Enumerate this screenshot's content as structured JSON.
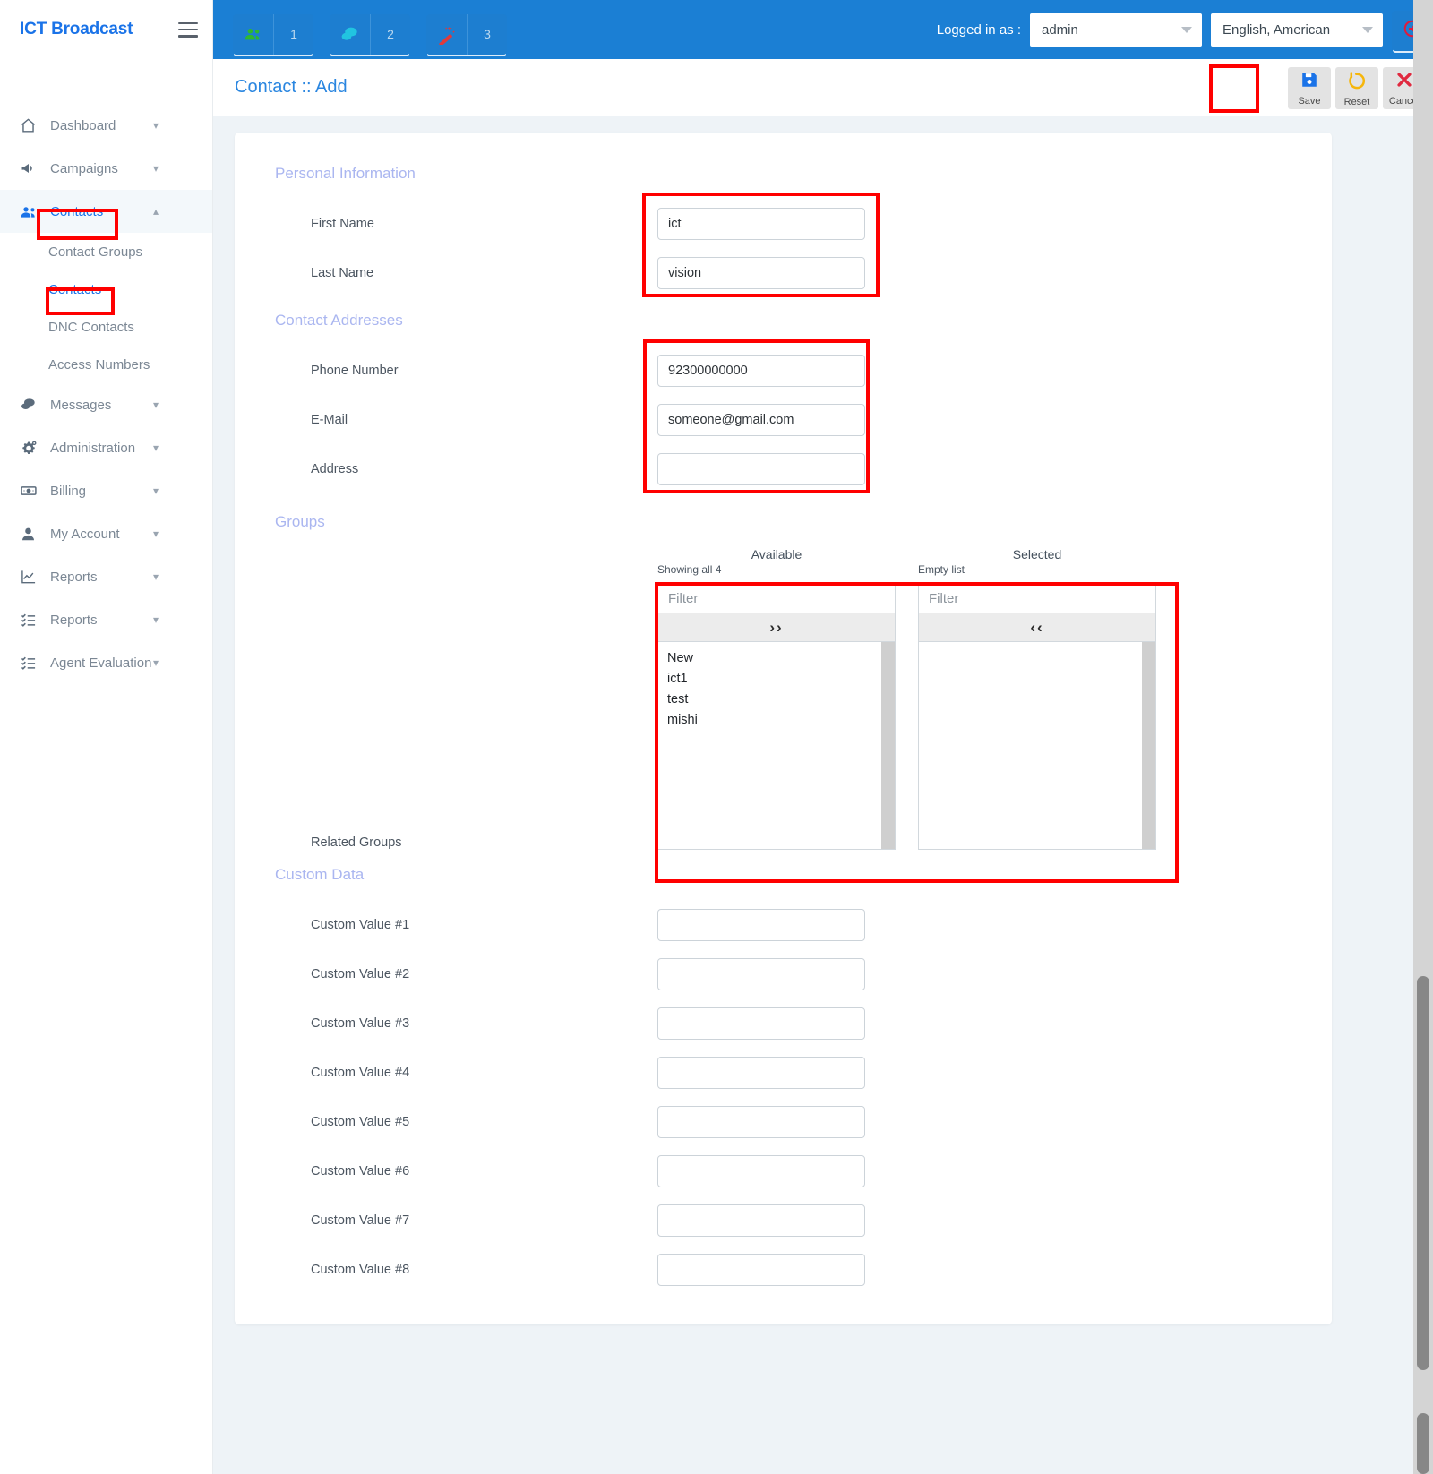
{
  "brand": {
    "title": "ICT Broadcast",
    "menu_icon": "hamburger-icon"
  },
  "sidebar": {
    "items": [
      {
        "label": "Dashboard",
        "icon": "home-icon",
        "chevron": "⌄",
        "active": false
      },
      {
        "label": "Campaigns",
        "icon": "megaphone-icon",
        "chevron": "⌄",
        "active": false
      },
      {
        "label": "Contacts",
        "icon": "users-icon",
        "chevron": "⌃",
        "active": true
      },
      {
        "label": "Messages",
        "icon": "chat-icon",
        "chevron": "⌄",
        "active": false
      },
      {
        "label": "Administration",
        "icon": "gears-icon",
        "chevron": "⌄",
        "active": false
      },
      {
        "label": "Billing",
        "icon": "money-icon",
        "chevron": "⌄",
        "active": false
      },
      {
        "label": "My Account",
        "icon": "user-icon",
        "chevron": "⌄",
        "active": false
      },
      {
        "label": "Reports",
        "icon": "chart-line-icon",
        "chevron": "⌄",
        "active": false
      },
      {
        "label": "Reports",
        "icon": "list-check-icon",
        "chevron": "⌄",
        "active": false
      },
      {
        "label": "Agent Evaluation",
        "icon": "list-check-icon",
        "chevron": "⌄",
        "active": false
      }
    ],
    "contacts_submenu": [
      {
        "label": "Contact Groups",
        "current": false
      },
      {
        "label": "Contacts",
        "current": true
      },
      {
        "label": "DNC Contacts",
        "current": false
      },
      {
        "label": "Access Numbers",
        "current": false
      }
    ]
  },
  "topbar": {
    "badges": [
      {
        "icon": "users-green-icon",
        "count": "1",
        "color": "#2eb82e"
      },
      {
        "icon": "chat-cyan-icon",
        "count": "2",
        "color": "#21c4e0"
      },
      {
        "icon": "magic-wand-red-icon",
        "count": "3",
        "color": "#e03a3a"
      }
    ],
    "logged_in_label": "Logged in as :",
    "user_select": "admin",
    "language_select": "English, American",
    "logout_icon": "logout-icon"
  },
  "page": {
    "title": "Contact :: Add",
    "toolbar": [
      {
        "label": "Save",
        "icon": "floppy-save-icon"
      },
      {
        "label": "Reset",
        "icon": "undo-reset-icon"
      },
      {
        "label": "Cancel",
        "icon": "x-cancel-icon"
      }
    ]
  },
  "form": {
    "sections": {
      "personal": "Personal Information",
      "addresses": "Contact Addresses",
      "groups": "Groups",
      "custom": "Custom Data"
    },
    "personal_fields": [
      {
        "label": "First Name",
        "value": "ict"
      },
      {
        "label": "Last Name",
        "value": "vision"
      }
    ],
    "address_fields": [
      {
        "label": "Phone Number",
        "value": "92300000000"
      },
      {
        "label": "E-Mail",
        "value": "someone@gmail.com"
      },
      {
        "label": "Address",
        "value": ""
      }
    ],
    "related_groups_label": "Related Groups",
    "duallist": {
      "available": {
        "title": "Available",
        "subtitle": "Showing all 4",
        "filter_placeholder": "Filter",
        "action": "››",
        "items": [
          "New",
          "ict1",
          "test",
          "mishi"
        ]
      },
      "selected": {
        "title": "Selected",
        "subtitle": "Empty list",
        "filter_placeholder": "Filter",
        "action": "‹‹",
        "items": []
      }
    },
    "custom_fields": [
      {
        "label": "Custom Value #1",
        "value": ""
      },
      {
        "label": "Custom Value #2",
        "value": ""
      },
      {
        "label": "Custom Value #3",
        "value": ""
      },
      {
        "label": "Custom Value #4",
        "value": ""
      },
      {
        "label": "Custom Value #5",
        "value": ""
      },
      {
        "label": "Custom Value #6",
        "value": ""
      },
      {
        "label": "Custom Value #7",
        "value": ""
      },
      {
        "label": "Custom Value #8",
        "value": ""
      }
    ]
  },
  "colors": {
    "brand_blue": "#1a73e8",
    "topbar_blue": "#1b7fd4",
    "section_label": "#aab6f0",
    "highlight_red": "#ff0000"
  }
}
